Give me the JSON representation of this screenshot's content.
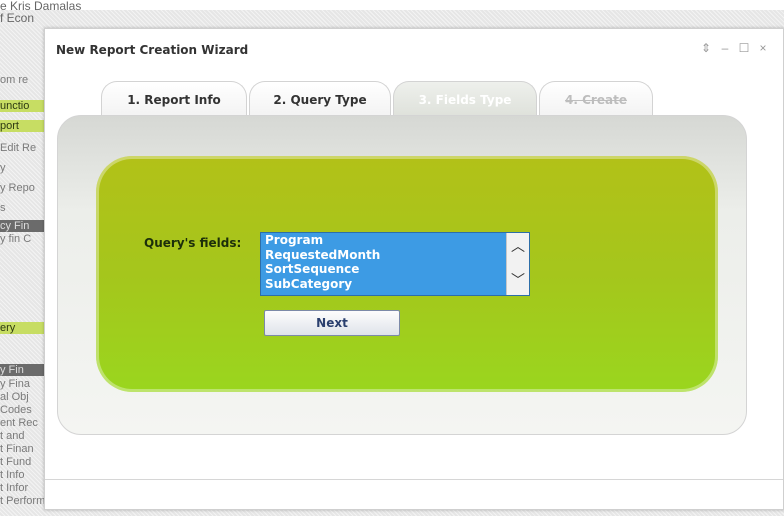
{
  "window": {
    "title": "New Report Creation Wizard",
    "controls": [
      "⇕",
      "–",
      "☐",
      "×"
    ]
  },
  "tabs": [
    {
      "label": "1. Report Info",
      "state": "normal"
    },
    {
      "label": "2. Query Type",
      "state": "normal"
    },
    {
      "label": "3. Fields Type",
      "state": "active"
    },
    {
      "label": "4. Create",
      "state": "disabled"
    }
  ],
  "form": {
    "fields_label": "Query's fields:",
    "fields_options": [
      "Program",
      "RequestedMonth",
      "SortSequence",
      "SubCategory"
    ],
    "next_label": "Next"
  },
  "background": {
    "user_line1": "e Kris Damalas",
    "user_line2": "f Econ",
    "left_fragments": [
      "om re",
      "unctio",
      "port",
      "Edit Re",
      "y",
      "y Repo",
      "s",
      "cy Fin",
      "y fin C",
      "ery",
      "y Fin",
      "y Fina",
      "al Obj",
      "Codes",
      "ent Rec",
      "t and",
      "t Finan",
      "t Fund",
      "t Info",
      "t Infor",
      "t Performance"
    ]
  },
  "colors": {
    "green_top": "#b2c118",
    "green_bottom": "#9ad61e",
    "listbox_blue": "#3d9be4",
    "nav_highlight": "#c7dd63"
  }
}
